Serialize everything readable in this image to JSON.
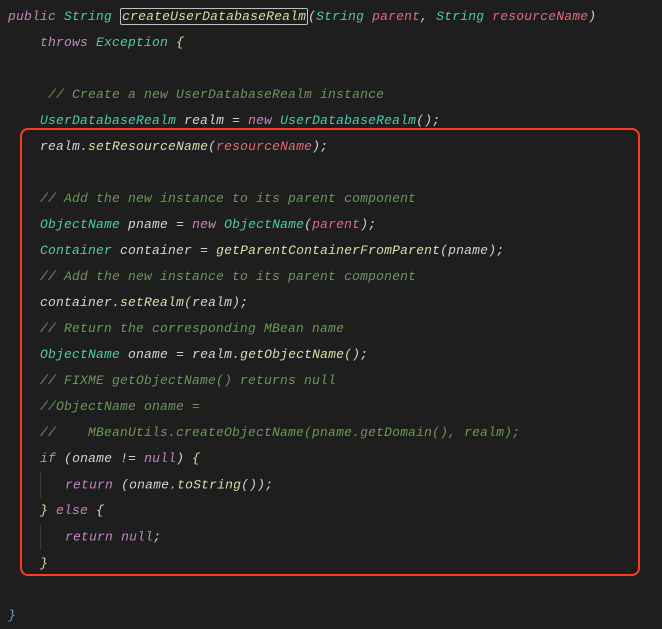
{
  "code": {
    "l1_public": "public",
    "l1_string": "String",
    "l1_method": "createUserDatabaseRealm",
    "l1_lp": "(",
    "l1_t1": "String",
    "l1_p1": "parent",
    "l1_c": ",",
    "l1_t2": "String",
    "l1_p2": "resourceName",
    "l1_rp": ")",
    "l2_throws": "throws",
    "l2_exc": "Exception",
    "l2_brace": "{",
    "l4_comment": "// Create a new UserDatabaseRealm instance",
    "l5_type": "UserDatabaseRealm",
    "l5_var": "realm",
    "l5_eq": "=",
    "l5_new": "new",
    "l5_ctor": "UserDatabaseRealm",
    "l5_end": "();",
    "l6_obj": "realm",
    "l6_dot": ".",
    "l6_call": "setResourceName",
    "l6_lp": "(",
    "l6_arg": "resourceName",
    "l6_end": ");",
    "l8_comment": "// Add the new instance to its parent component",
    "l9_type": "ObjectName",
    "l9_var": "pname",
    "l9_eq": "=",
    "l9_new": "new",
    "l9_ctor": "ObjectName",
    "l9_lp": "(",
    "l9_arg": "parent",
    "l9_end": ");",
    "l10_type": "Container",
    "l10_var": "container",
    "l10_eq": "=",
    "l10_call": "getParentContainerFromParent",
    "l10_lp": "(",
    "l10_arg": "pname",
    "l10_end": ");",
    "l11_comment": "// Add the new instance to its parent component",
    "l12_obj": "container",
    "l12_dot": ".",
    "l12_call": "setRealm",
    "l12_lp": "(",
    "l12_arg": "realm",
    "l12_end": ");",
    "l13_comment": "// Return the corresponding MBean name",
    "l14_type": "ObjectName",
    "l14_var": "oname",
    "l14_eq": "=",
    "l14_obj": "realm",
    "l14_dot": ".",
    "l14_call": "getObjectName",
    "l14_end": "();",
    "l15_comment": "// FIXME getObjectName() returns null",
    "l16_comment": "//ObjectName oname =",
    "l17_comment": "//    MBeanUtils.createObjectName(pname.getDomain(), realm);",
    "l18_if": "if",
    "l18_lp": "(",
    "l18_var": "oname",
    "l18_op": "!=",
    "l18_null": "null",
    "l18_rp": ")",
    "l18_brace": "{",
    "l19_return": "return",
    "l19_lp": "(",
    "l19_obj": "oname",
    "l19_dot": ".",
    "l19_call": "toString",
    "l19_end": "());",
    "l20_brace": "}",
    "l20_else": "else",
    "l20_brace2": "{",
    "l21_return": "return",
    "l21_null": "null",
    "l21_semi": ";",
    "l22_brace": "}",
    "l24_brace": "}"
  }
}
